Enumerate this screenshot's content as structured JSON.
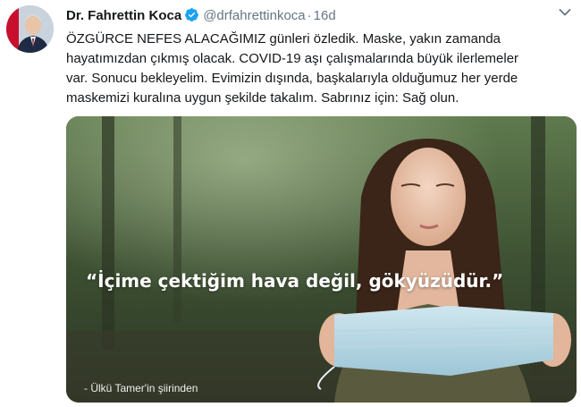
{
  "tweet": {
    "author_name": "Dr. Fahrettin Koca",
    "handle": "@drfahrettinkoca",
    "separator": "·",
    "timestamp": "16d",
    "verified": true,
    "text": "ÖZGÜRCE NEFES ALACAĞIMIZ günleri özledik. Maske, yakın zamanda\nhayatımızdan çıkmış olacak. COVID-19 aşı çalışmalarında büyük ilerlemeler\nvar. Sonucu bekleyelim. Evimizin dışında, başkalarıyla olduğumuz her yerde\nmaskemizi kuralına uygun şekilde takalım. Sabrınız için: Sağ olun."
  },
  "media": {
    "quote": "“İçime çektiğim hava değil, gökyüzüdür.”",
    "credit": "- Ülkü Tamer'in şiirinden"
  },
  "icons": {
    "verified": "verified-badge-icon",
    "more": "chevron-down-icon"
  },
  "colors": {
    "verified_blue": "#1da1f2",
    "secondary_text": "#657786",
    "primary_text": "#14171a"
  }
}
